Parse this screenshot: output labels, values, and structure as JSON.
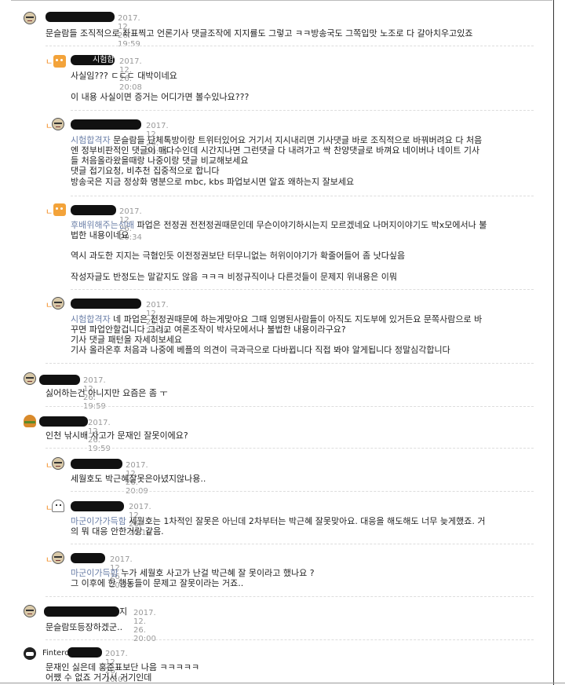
{
  "comments": [
    {
      "id": "c1",
      "time": "2017. 12. 26.  19:59",
      "lines": [
        "문슬람들 조직적으로 좌표찍고 언론기사 댓글조작에 지지률도 그렇고 ㅋㅋ방송국도 그쪽입맛 노조로 다 갈아치우고있죠"
      ]
    },
    {
      "id": "c1r1",
      "nick": "시험합격자",
      "time": "2017. 12. 26.  20:08",
      "lines": [
        "사실임??? ㄷㄷㄷ 대박이네요",
        "",
        "이 내용 사실이면 증거는 어디가면 볼수있나요???"
      ]
    },
    {
      "id": "c1r2",
      "time": "2017. 12. 26.  20:19",
      "tag": "시험합격자",
      "lines": [
        "문슬람들 단체톡방이랑 트위터있어요 거기서 지시내리면 기사댓글 바로 조직적으로 바꿔버려요 다 처음",
        "엔 정부비판적인 댓글이 매다수인데 시간지나면 그런댓글 다 내려가고 싹 찬양댓글로 바껴요 네이버나 네이트 기사",
        "들 처음올라왔을때랑 나중이랑 댓글 비교해보세요",
        "댓글 접기요청, 비추천 집중적으로 합니다",
        "방송국은 지금 정상화 명분으로 mbc, kbs 파업보시면 알죠 왜하는지 잘보세요"
      ]
    },
    {
      "id": "c1r3",
      "time": "2017. 12. 26.  20:34",
      "tag": "후배위해주는선배",
      "lines": [
        "파업은 전정권 전전정권때문인데 무슨이야기하시는지 모르겠네요 나머지이야기도 박x모에서나 불",
        "법한 내용이네요",
        "",
        "역시 과도한 지지는 극혐인듯 이전정권보단 터무니없는 허위이야기가 확줄어들어 좀 낫다싶음",
        "",
        "작성자글도 반정도는 말같지도 않음 ㅋㅋㅋ 비정규직이나 다른것들이 문제지 위내용은 이뭐"
      ]
    },
    {
      "id": "c1r4",
      "time": "2017. 12. 26.  20:39",
      "tag": "시험합격자",
      "lines": [
        "네 파업은 전정권때문에 하는게맞아요 그때 임명된사람들이 아직도 지도부에 있거든요 문쪽사람으로 바",
        "꾸면 파업안할겁니다 그리고 여론조작이 박사모에서나 불법한 내용이라구요?",
        "기사 댓글 패턴을 자세히보세요",
        "기사 올라온후 처음과 나중에 베플의 의견이 극과극으로 다바뀝니다 직접 봐야 알게됩니다 정말심각합니다"
      ]
    },
    {
      "id": "c2",
      "time": "2017. 12. 26.  19:59",
      "lines": [
        "싫어하는건 아니지만 요즘은 좀 ㅜ"
      ]
    },
    {
      "id": "c3",
      "time": "2017. 12. 26.  19:59",
      "lines": [
        "인천 낚시배 사고가 문재인 잘못이에요?"
      ]
    },
    {
      "id": "c3r1",
      "time": "2017. 12. 26.  20:09",
      "lines": [
        "세월호도 박근혜잘못은아녔지않나용.."
      ]
    },
    {
      "id": "c3r2",
      "time": "2017. 12. 26.  20:19",
      "tag": "마군이가가득함",
      "lines": [
        "세월호는 1차적인 잘못은 아닌데 2차부터는 박근혜 잘못맞아요. 대응을 해도해도 너무 늦게했죠. 거",
        "의 뭐 대응 안한거랑 같음."
      ]
    },
    {
      "id": "c3r3",
      "time": "2017. 12. 26.  20:21",
      "tag": "마군이가득함",
      "lines": [
        "누가 세월호 사고가 난걸 박근혜 잘 못이라고 했나요 ?",
        "그 이후에 한 행동들이 문제고 잘못이라는 거죠.."
      ]
    },
    {
      "id": "c4",
      "nick_tail": "지",
      "time": "2017. 12. 26.  20:00",
      "lines": [
        "문슬람또등장하겠군.."
      ]
    },
    {
      "id": "c5",
      "time": "2017. 12. 26.  20:00",
      "lines": [
        "문재인 싫은데 홍준표보단 나음 ㅋㅋㅋㅋㅋ",
        "어쨌 수 없죠 거기서 거기인데"
      ]
    }
  ],
  "partial_nick_peek": "Fintercat",
  "colors": {
    "timestamp": "#999999",
    "tag": "#6b7fa8",
    "reply_mark": "#f07a00",
    "redaction": "#111111"
  }
}
